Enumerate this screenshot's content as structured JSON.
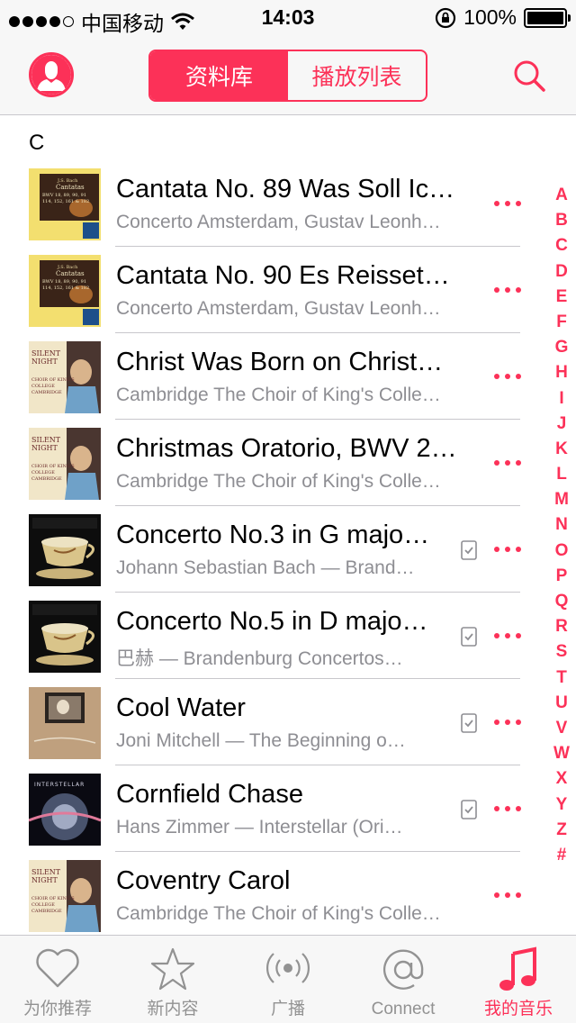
{
  "status_bar": {
    "carrier": "中国移动",
    "time": "14:03",
    "battery": "100%"
  },
  "nav": {
    "segments": [
      "资料库",
      "播放列表"
    ],
    "active_segment": 0
  },
  "section": {
    "letter": "C"
  },
  "songs": [
    {
      "title": "Cantata No. 89 Was Soll Ic…",
      "subtitle": "Concerto Amsterdam, Gustav Leonh…",
      "art": "cantata",
      "downloaded": false
    },
    {
      "title": "Cantata No. 90 Es Reisset…",
      "subtitle": "Concerto Amsterdam, Gustav Leonh…",
      "art": "cantata",
      "downloaded": false
    },
    {
      "title": "Christ Was Born on Christ…",
      "subtitle": "Cambridge The Choir of King's Colle…",
      "art": "silent-night",
      "downloaded": false
    },
    {
      "title": "Christmas Oratorio, BWV 2…",
      "subtitle": "Cambridge The Choir of King's Colle…",
      "art": "silent-night",
      "downloaded": false
    },
    {
      "title": "Concerto No.3 in G majo…",
      "subtitle": "Johann Sebastian Bach — Brand…",
      "art": "teacup",
      "downloaded": true
    },
    {
      "title": "Concerto No.5 in D majo…",
      "subtitle": "巴赫 — Brandenburg Concertos…",
      "art": "teacup",
      "downloaded": true
    },
    {
      "title": "Cool Water",
      "subtitle": "Joni Mitchell — The Beginning o…",
      "art": "cool-water",
      "downloaded": true
    },
    {
      "title": "Cornfield Chase",
      "subtitle": "Hans Zimmer — Interstellar (Ori…",
      "art": "interstellar",
      "downloaded": true
    },
    {
      "title": "Coventry Carol",
      "subtitle": "Cambridge The Choir of King's Colle…",
      "art": "silent-night",
      "downloaded": false
    }
  ],
  "index_letters": [
    "A",
    "B",
    "C",
    "D",
    "E",
    "F",
    "G",
    "H",
    "I",
    "J",
    "K",
    "L",
    "M",
    "N",
    "O",
    "P",
    "Q",
    "R",
    "S",
    "T",
    "U",
    "V",
    "W",
    "X",
    "Y",
    "Z",
    "#"
  ],
  "tabs": [
    {
      "label": "为你推荐",
      "icon": "heart-icon",
      "active": false
    },
    {
      "label": "新内容",
      "icon": "star-icon",
      "active": false
    },
    {
      "label": "广播",
      "icon": "radio-icon",
      "active": false
    },
    {
      "label": "Connect",
      "icon": "at-icon",
      "active": false
    },
    {
      "label": "我的音乐",
      "icon": "music-note-icon",
      "active": true
    }
  ],
  "colors": {
    "accent": "#fc3158",
    "secondary_text": "#8e8e93",
    "bar_bg": "#f7f7f7",
    "separator": "#c8c7cc"
  },
  "art_text": {
    "cantata": {
      "line1": "J.S. Bach",
      "line2": "Cantatas",
      "line3": "BWV 18, 89, 90, 91",
      "line4": "114, 152, 161 & 182"
    },
    "silent_night": {
      "line1": "SILENT",
      "line2": "NIGHT",
      "line3": "CHOIR OF KING'S",
      "line4": "COLLEGE",
      "line5": "CAMBRIDGE"
    },
    "interstellar": {
      "line1": "INTERSTELLAR"
    }
  }
}
